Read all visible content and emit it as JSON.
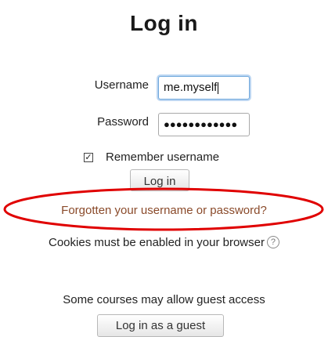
{
  "title": "Log in",
  "form": {
    "username_label": "Username",
    "username_value": "me.myself",
    "password_label": "Password",
    "password_mask": "●●●●●●●●●●●●",
    "remember_label": "Remember username",
    "remember_checked": true,
    "checkbox_mark": "✓",
    "login_button": "Log in"
  },
  "forgot_link": "Forgotten your username or password?",
  "annotation_color": "#e00000",
  "cookies_notice": "Cookies must be enabled in your browser",
  "help_icon_glyph": "?",
  "guest": {
    "notice": "Some courses may allow guest access",
    "button": "Log in as a guest"
  }
}
